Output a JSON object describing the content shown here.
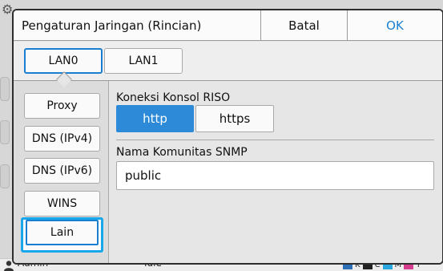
{
  "background": {
    "status_user": "Admin",
    "status_text": "Idle",
    "ink_labels": [
      "K",
      "C",
      "M",
      "Y"
    ],
    "ink_colors": [
      "#222222",
      "#29a8e0",
      "#d63d8e",
      "#f2d21b"
    ]
  },
  "dialog": {
    "title": "Pengaturan Jaringan (Rincian)",
    "cancel_label": "Batal",
    "ok_label": "OK"
  },
  "lan_tabs": [
    {
      "label": "LAN0",
      "active": true
    },
    {
      "label": "LAN1",
      "active": false
    }
  ],
  "side_menu": [
    {
      "label": "Proxy"
    },
    {
      "label": "DNS (IPv4)"
    },
    {
      "label": "DNS (IPv6)"
    },
    {
      "label": "WINS"
    },
    {
      "label": "Lain",
      "active": true
    }
  ],
  "riso": {
    "label": "Koneksi Konsol RISO",
    "options": [
      "http",
      "https"
    ],
    "selected": "http"
  },
  "snmp": {
    "label": "Nama Komunitas SNMP",
    "value": "public"
  },
  "colors": {
    "accent": "#1a7fd0",
    "selected_fill": "#2c8ad8",
    "focus_ring": "#17a7ea"
  }
}
